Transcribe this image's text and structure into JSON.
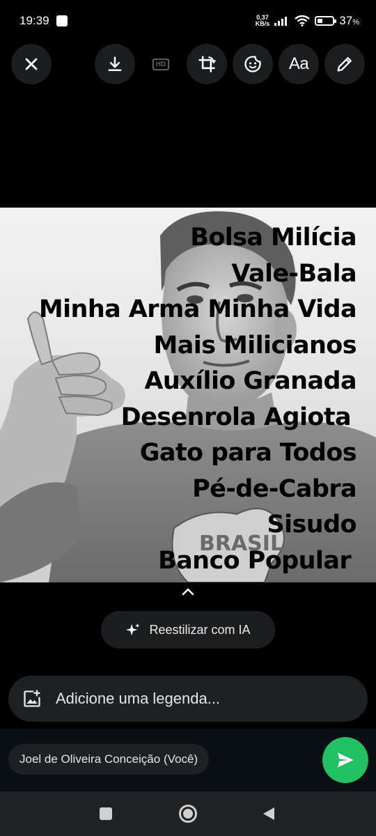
{
  "status_bar": {
    "time": "19:39",
    "net_speed_value": "0,37",
    "net_speed_unit": "KB/s",
    "battery_percent": "37",
    "battery_suffix": "%"
  },
  "toolbar": {
    "hd_label": "HD",
    "text_tool_label": "Aa",
    "icons": [
      "close-icon",
      "download-icon",
      "hd-icon",
      "crop-rotate-icon",
      "sticker-icon",
      "text-icon",
      "pencil-icon"
    ]
  },
  "media": {
    "overlay_lines": [
      "Bolsa Milícia",
      "Vale-Bala",
      "Minha Arma Minha Vida",
      "Mais Milicianos",
      "Auxílio Granada",
      "Desenrola Agiota",
      "Gato para Todos",
      "Pé-de-Cabra",
      "Sisudo",
      "Banco Popular"
    ],
    "shirt_text": "BRASIL"
  },
  "ai_button": {
    "label": "Reestilizar com IA"
  },
  "caption": {
    "placeholder": "Adicione uma legenda..."
  },
  "recipient": {
    "name": "Joel de Oliveira Conceição (Você)"
  },
  "colors": {
    "send_button": "#21c063",
    "toolbar_button": "#1b1d1e",
    "caption_bar": "#1e2124",
    "bottom_panel": "#0b1014",
    "nav_bar": "#1f2122"
  }
}
